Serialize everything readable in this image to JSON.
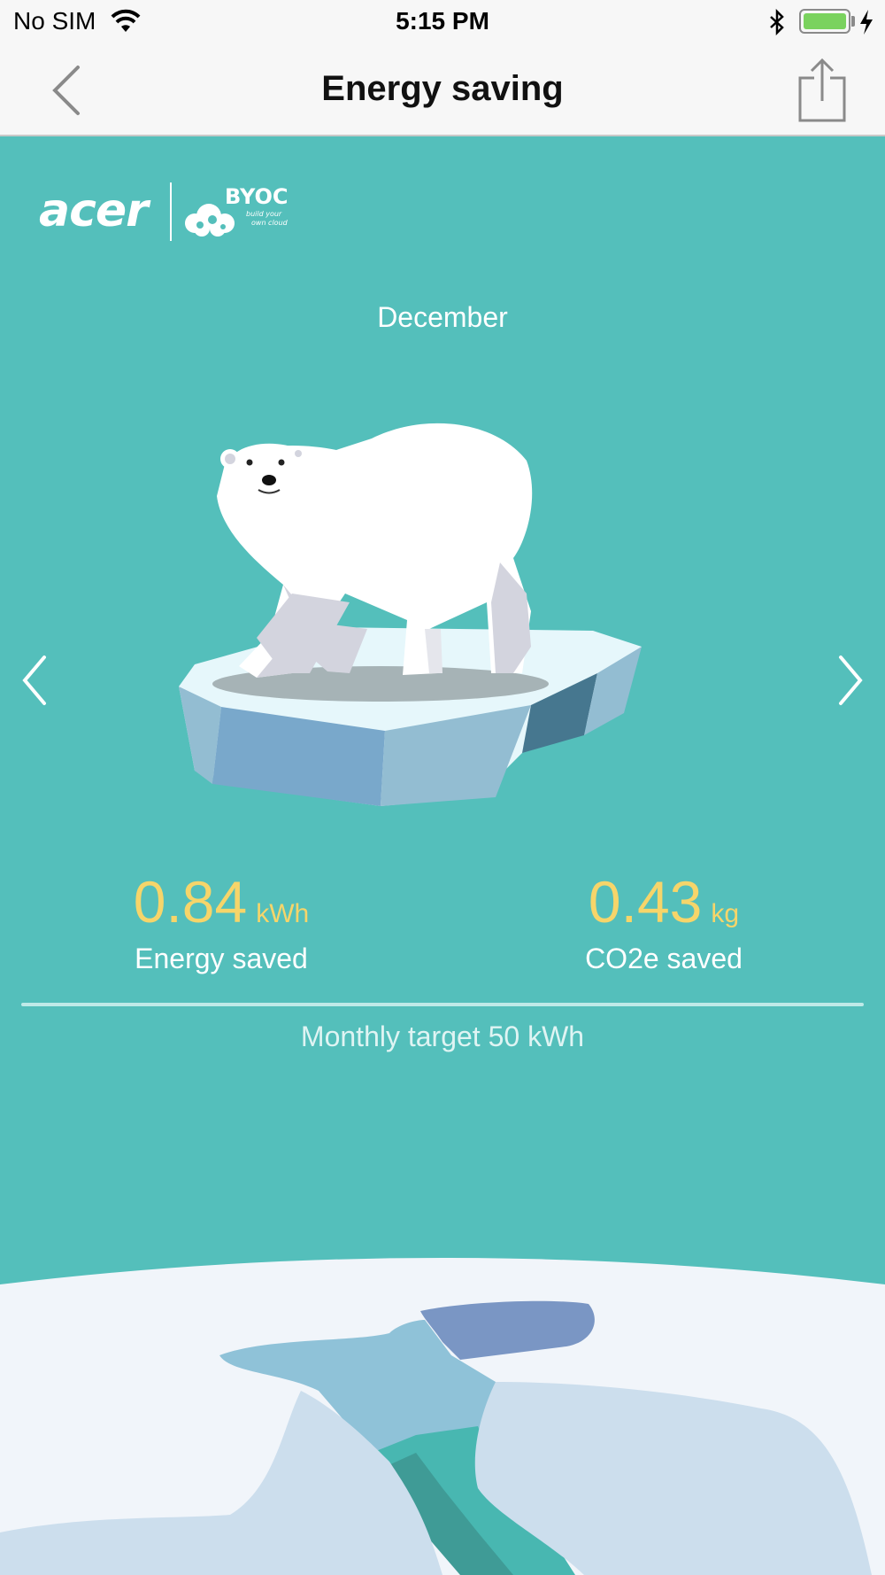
{
  "status_bar": {
    "carrier": "No SIM",
    "time": "5:15 PM",
    "wifi_icon": "wifi-icon",
    "bluetooth_icon": "bluetooth-icon",
    "battery_icon": "battery-icon",
    "charging_icon": "charging-icon",
    "battery_level": 1.0
  },
  "nav": {
    "title": "Energy saving",
    "back_icon": "chevron-left-icon",
    "share_icon": "share-icon"
  },
  "logo": {
    "brand": "acer",
    "product": "BYOC",
    "tagline": "build your own cloud"
  },
  "month": "December",
  "stats": {
    "energy": {
      "value": "0.84",
      "unit": "kWh",
      "label": "Energy saved"
    },
    "co2": {
      "value": "0.43",
      "unit": "kg",
      "label": "CO2e saved"
    }
  },
  "target": {
    "text": "Monthly target 50 kWh"
  },
  "colors": {
    "background": "#54bfbb",
    "accent_yellow": "#f6d56a",
    "bar_bg": "#f7f7f7",
    "battery_green": "#7ad25e"
  }
}
